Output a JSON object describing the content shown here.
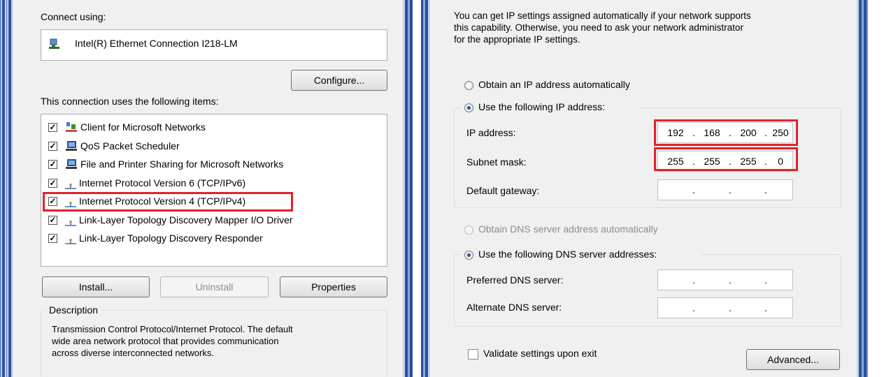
{
  "left": {
    "connect_using_label": "Connect using:",
    "adapter_name": "Intel(R) Ethernet Connection I218-LM",
    "configure_button": "Configure...",
    "items_label": "This connection uses the following items:",
    "items": [
      {
        "label": "Client for Microsoft Networks",
        "checked": true,
        "icon": "network-client-icon"
      },
      {
        "label": "QoS Packet Scheduler",
        "checked": true,
        "icon": "computer-icon"
      },
      {
        "label": "File and Printer Sharing for Microsoft Networks",
        "checked": true,
        "icon": "computer-icon"
      },
      {
        "label": "Internet Protocol Version 6 (TCP/IPv6)",
        "checked": true,
        "icon": "protocol-icon"
      },
      {
        "label": "Internet Protocol Version 4 (TCP/IPv4)",
        "checked": true,
        "icon": "protocol-icon",
        "highlighted": true
      },
      {
        "label": "Link-Layer Topology Discovery Mapper I/O Driver",
        "checked": true,
        "icon": "protocol-icon"
      },
      {
        "label": "Link-Layer Topology Discovery Responder",
        "checked": true,
        "icon": "protocol-icon"
      }
    ],
    "install_button": "Install...",
    "uninstall_button": "Uninstall",
    "properties_button": "Properties",
    "description_title": "Description",
    "description_text": [
      "Transmission Control Protocol/Internet Protocol. The default",
      "wide area network protocol that provides communication",
      "across diverse interconnected networks."
    ]
  },
  "right": {
    "intro": [
      "You can get IP settings assigned automatically if your network supports",
      "this capability. Otherwise, you need to ask your network administrator",
      "for the appropriate IP settings."
    ],
    "obtain_ip_auto": "Obtain an IP address automatically",
    "use_following_ip": "Use the following IP address:",
    "ip_address_label": "IP address:",
    "ip_address": [
      "192",
      "168",
      "200",
      "250"
    ],
    "subnet_mask_label": "Subnet mask:",
    "subnet_mask": [
      "255",
      "255",
      "255",
      "0"
    ],
    "default_gateway_label": "Default gateway:",
    "default_gateway": [
      "",
      "",
      "",
      ""
    ],
    "obtain_dns_auto": "Obtain DNS server address automatically",
    "use_following_dns": "Use the following DNS server addresses:",
    "preferred_dns_label": "Preferred DNS server:",
    "alternate_dns_label": "Alternate DNS server:",
    "validate_label": "Validate settings upon exit",
    "advanced_button": "Advanced..."
  },
  "colors": {
    "highlight": "#e3222b",
    "frame_blue": "#2b4fa0",
    "dialog_bg": "#f0f0f0"
  }
}
